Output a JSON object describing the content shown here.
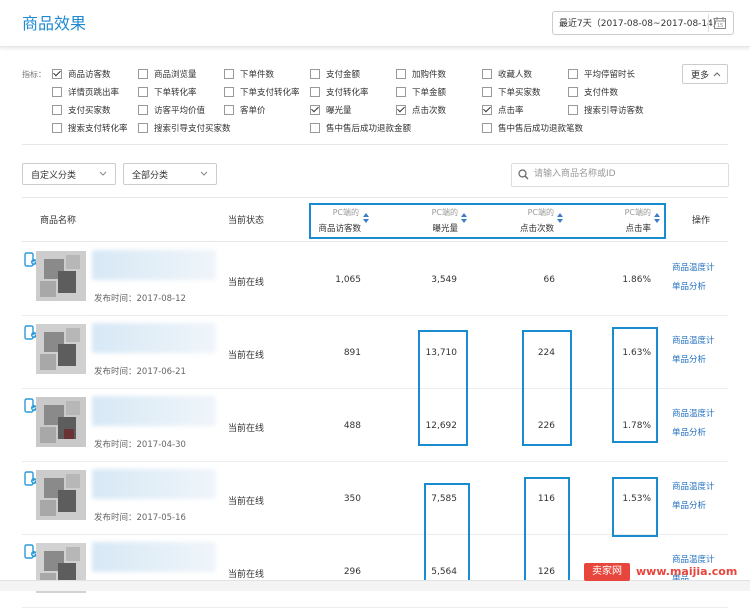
{
  "header": {
    "title": "商品效果",
    "date_range": "最近7天（2017-08-08~2017-08-14）",
    "calendar_day": "15"
  },
  "metrics": {
    "label": "指标：",
    "more_label": "更多",
    "items": [
      {
        "label": "商品访客数",
        "checked": true
      },
      {
        "label": "商品浏览量",
        "checked": false
      },
      {
        "label": "下单件数",
        "checked": false
      },
      {
        "label": "支付金额",
        "checked": false
      },
      {
        "label": "加购件数",
        "checked": false
      },
      {
        "label": "收藏人数",
        "checked": false
      },
      {
        "label": "平均停留时长",
        "checked": false
      },
      {
        "label": "详情页跳出率",
        "checked": false
      },
      {
        "label": "下单转化率",
        "checked": false
      },
      {
        "label": "下单支付转化率",
        "checked": false
      },
      {
        "label": "支付转化率",
        "checked": false
      },
      {
        "label": "下单金额",
        "checked": false
      },
      {
        "label": "下单买家数",
        "checked": false
      },
      {
        "label": "支付件数",
        "checked": false
      },
      {
        "label": "支付买家数",
        "checked": false
      },
      {
        "label": "访客平均价值",
        "checked": false
      },
      {
        "label": "客单价",
        "checked": false
      },
      {
        "label": "曝光量",
        "checked": true
      },
      {
        "label": "点击次数",
        "checked": true
      },
      {
        "label": "点击率",
        "checked": true
      },
      {
        "label": "搜索引导访客数",
        "checked": false
      },
      {
        "label": "搜索支付转化率",
        "checked": false
      },
      {
        "label": "搜索引导支付买家数",
        "checked": false
      },
      {
        "label": "售中售后成功退款金额",
        "checked": false
      },
      {
        "label": "售中售后成功退款笔数",
        "checked": false
      }
    ]
  },
  "filters": {
    "category_custom": "自定义分类",
    "category_all": "全部分类",
    "search_placeholder": "请输入商品名称或ID"
  },
  "table": {
    "headers": {
      "name": "商品名称",
      "status": "当前状态",
      "col1_sub": "PC端的",
      "col1_main": "商品访客数",
      "col2_sub": "PC端的",
      "col2_main": "曝光量",
      "col3_sub": "PC端的",
      "col3_main": "点击次数",
      "col4_sub": "PC端的",
      "col4_main": "点击率",
      "action": "操作"
    },
    "rows": [
      {
        "publish": "发布时间：2017-08-12",
        "status": "当前在线",
        "visitors": "1,065",
        "exposure": "3,549",
        "clicks": "66",
        "ctr": "1.86%",
        "link1": "商品温度计",
        "link2": "单品分析"
      },
      {
        "publish": "发布时间：2017-06-21",
        "status": "当前在线",
        "visitors": "891",
        "exposure": "13,710",
        "clicks": "224",
        "ctr": "1.63%",
        "link1": "商品温度计",
        "link2": "单品分析"
      },
      {
        "publish": "发布时间：2017-04-30",
        "status": "当前在线",
        "visitors": "488",
        "exposure": "12,692",
        "clicks": "226",
        "ctr": "1.78%",
        "link1": "商品温度计",
        "link2": "单品分析"
      },
      {
        "publish": "发布时间：2017-05-16",
        "status": "当前在线",
        "visitors": "350",
        "exposure": "7,585",
        "clicks": "116",
        "ctr": "1.53%",
        "link1": "商品温度计",
        "link2": "单品分析"
      },
      {
        "publish": "",
        "status": "当前在线",
        "visitors": "296",
        "exposure": "5,564",
        "clicks": "126",
        "ctr": "",
        "link1": "商品温度计",
        "link2": "单品"
      }
    ]
  },
  "watermark": {
    "badge": "卖家网",
    "url": "www.maijia.com"
  },
  "colors": {
    "accent": "#1f8ad2",
    "highlight_box": "#1a8bd0",
    "link": "#1f6fbf",
    "watermark": "#e8463c"
  }
}
